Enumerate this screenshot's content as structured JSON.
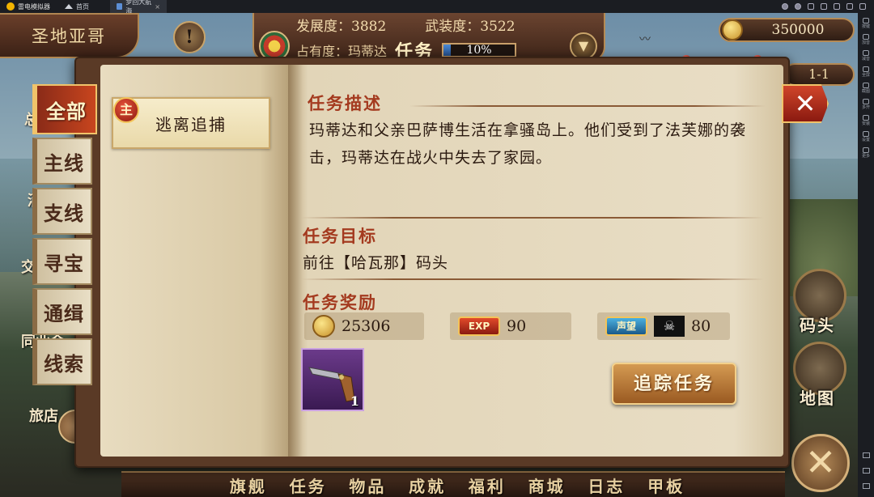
{
  "emulator": {
    "brand": "雷电模拟器",
    "tabs": [
      {
        "label": "首页"
      },
      {
        "label": "梦回大航海"
      }
    ],
    "sidebar": [
      "按键",
      "加音",
      "减音",
      "全屏",
      "截图",
      "多开",
      "安装",
      "设置",
      "更多"
    ]
  },
  "hud": {
    "location": "圣地亚哥",
    "development": "发展度：3882",
    "armament": "武装度：3522",
    "occupancy": "占有度：玛蒂达",
    "mission_label": "任务",
    "mission_progress_text": "10%",
    "mission_progress": 0.1,
    "gold": "350000",
    "level": "1-1"
  },
  "left_peek": [
    "总",
    "酒馆",
    "交",
    "同业会",
    "旅店"
  ],
  "right_nav": {
    "dock": "码头",
    "map": "地图"
  },
  "bottom_nav": [
    "旗舰",
    "任务",
    "物品",
    "成就",
    "福利",
    "商城",
    "日志",
    "甲板"
  ],
  "quest_panel": {
    "tabs": [
      "全部",
      "主线",
      "支线",
      "寻宝",
      "通缉",
      "线索"
    ],
    "active_tab": "全部",
    "quest_list": [
      {
        "badge": "主",
        "title": "逃离追捕"
      }
    ],
    "description_title": "任务描述",
    "description": "玛蒂达和父亲巴萨博生活在拿骚岛上。他们受到了法芙娜的袭击，玛蒂达在战火中失去了家园。",
    "target_title": "任务目标",
    "target": "前往【哈瓦那】码头",
    "reward_title": "任务奖励",
    "rewards": {
      "gold": "25306",
      "exp_label": "EXP",
      "exp": "90",
      "reputation_label": "声望",
      "reputation": "80"
    },
    "reward_item_count": "1",
    "track_button": "追踪任务",
    "close_symbol": "✕"
  },
  "colors": {
    "accent_red": "#a43a1f",
    "parchment": "#e8ddc4",
    "wood": "#5a3a26",
    "progress_blue": "#3a78c4"
  }
}
